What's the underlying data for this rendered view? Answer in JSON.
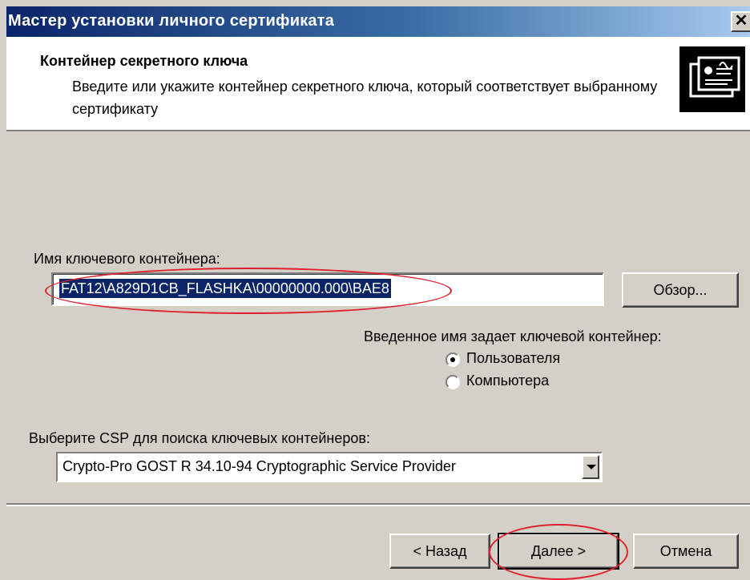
{
  "window": {
    "title": "Мастер установки личного сертификата",
    "close_glyph": "✕"
  },
  "header": {
    "title": "Контейнер секретного ключа",
    "description": "Введите или укажите контейнер секретного ключа, который соответствует выбранному сертификату",
    "icon": "certificate-icon"
  },
  "container": {
    "label": "Имя ключевого контейнера:",
    "value": "FAT12\\A829D1CB_FLASHKA\\00000000.000\\BAE8",
    "browse_label": "Обзор..."
  },
  "scope": {
    "label": "Введенное имя задает ключевой контейнер:",
    "options": [
      {
        "label": "Пользователя",
        "selected": true
      },
      {
        "label": "Компьютера",
        "selected": false
      }
    ]
  },
  "csp": {
    "label": "Выберите CSP для поиска ключевых контейнеров:",
    "selected": "Crypto-Pro GOST R 34.10-94 Cryptographic Service Provider"
  },
  "footer": {
    "back_label": "< Назад",
    "next_label": "Далее >",
    "cancel_label": "Отмена"
  },
  "colors": {
    "annotation": "#e0202a",
    "selection": "#0a246a",
    "face": "#d4d0c8"
  }
}
